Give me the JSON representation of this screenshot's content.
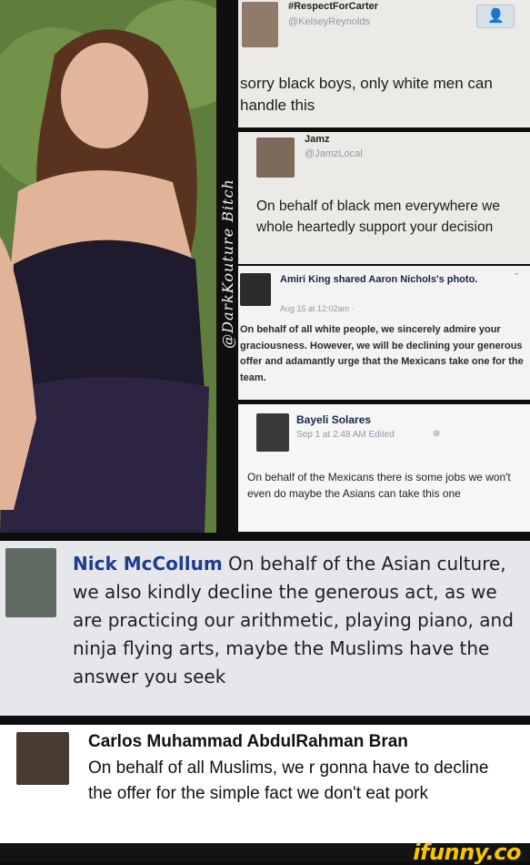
{
  "watermark": "@DarkKouture Bitch",
  "post1": {
    "handle": "#RespectForCarter",
    "username": "@KelseyReynolds",
    "text": "sorry black boys, only white men can handle this"
  },
  "post2": {
    "name": "Jamz",
    "username": "@JamzLocal",
    "text": "On behalf of black men everywhere we whole heartedly support your decision"
  },
  "post3": {
    "header": "Amiri King shared Aaron Nichols's photo.",
    "time": "Aug 15 at 12:02am · ",
    "text": "On behalf of all white people, we sincerely admire your graciousness. However, we will be declining your generous offer and adamantly urge that the Mexicans take one for the team."
  },
  "post4": {
    "name": "Bayeli Solares",
    "time": "Sep 1 at 2:48 AM Edited",
    "text": "On behalf of the Mexicans there is some jobs we won't  even do maybe the Asians can take this one"
  },
  "post5": {
    "name": "Nick McCollum",
    "text": "On behalf of the Asian culture, we also kindly decline the generous act, as we are practicing our arithmetic, playing piano, and ninja flying arts, maybe the Muslims have the answer you seek"
  },
  "post6": {
    "name": "Carlos Muhammad AbdulRahman Bran",
    "text": "On behalf of all Muslims, we r gonna have to decline the offer for the simple fact we don't eat pork"
  },
  "brand": "ifunny.co",
  "colors": {
    "link_name": "#1d3d8f",
    "brand": "#f7c600",
    "bg": "#0d0d0d"
  }
}
